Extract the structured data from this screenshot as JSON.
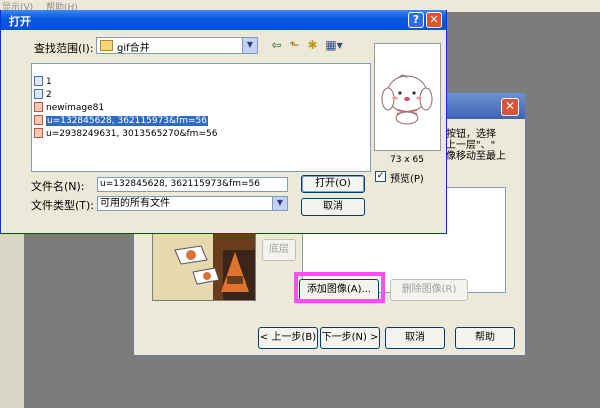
{
  "background_app": {
    "menu": [
      "显示(V)",
      "帮助(H)"
    ]
  },
  "wizard": {
    "close_glyph": "✕",
    "instructions": [
      "按钮，选择",
      "上一层\"、\"",
      "像移动至最上"
    ],
    "buttons": {
      "bottom_layer": "底层",
      "add_image": "添加图像(A)...",
      "remove_image": "删除图像(R)",
      "back": "< 上一步(B)",
      "next": "下一步(N) >",
      "cancel": "取消",
      "help": "帮助"
    },
    "highlight_color": "#ff4dff"
  },
  "open_dialog": {
    "title": "打开",
    "help_glyph": "?",
    "close_glyph": "✕",
    "look_in_label": "查找范围(I):",
    "look_in_value": "gif合并",
    "nav_icons": [
      "back-arrow-icon",
      "up-folder-icon",
      "new-folder-icon",
      "view-menu-icon"
    ],
    "files": [
      {
        "name": "1",
        "icon": "gif-file-icon",
        "selected": false
      },
      {
        "name": "2",
        "icon": "gif-file-icon",
        "selected": false
      },
      {
        "name": "newimage81",
        "icon": "image-file-icon",
        "selected": false
      },
      {
        "name": "u=132845628, 362115973&fm=56",
        "icon": "image-file-icon",
        "selected": true
      },
      {
        "name": "u=2938249631, 3013565270&fm=56",
        "icon": "image-file-icon",
        "selected": false
      }
    ],
    "file_name_label": "文件名(N):",
    "file_name_value": "u=132845628, 362115973&fm=56",
    "file_type_label": "文件类型(T):",
    "file_type_value": "可用的所有文件",
    "open_button": "打开(O)",
    "cancel_button": "取消",
    "preview_dims": "73 x 65",
    "preview_label": "预览(P)",
    "preview_checked": true,
    "check_glyph": "✓",
    "dropdown_glyph": "▼"
  }
}
